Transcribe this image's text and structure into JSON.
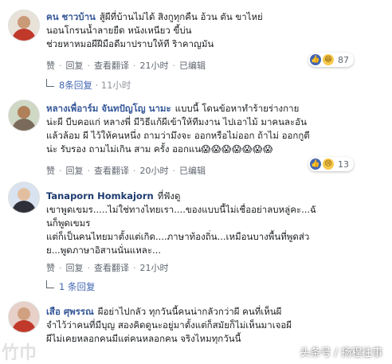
{
  "comments": [
    {
      "name": "คน ชาวบ้าน",
      "lines": [
        "สู้ผีที่บ้านไม่ได้ สิงกูทุกคืน อ้วน ตัน ขาไหย่",
        "นอนโกรนน้ำลายยืด หนังเหนียว ขี้บ่น",
        "ช่วยหาหมอผีฝีมือดีมาปราบให้ที ริาคาญมัน"
      ],
      "first_line_rest": "สู้ผีที่บ้านไม่ได้ สิงกูทุกคืน อ้วน ตัน ขาไหย่",
      "like": "赞",
      "reply": "回复",
      "translate": "查看翻译",
      "time": "21小时",
      "edited": "已编辑",
      "reaction_count": "87",
      "replies_text": "8条回复",
      "replies_time": "11小时"
    },
    {
      "name": "หลางเพื่อาร์ม จันทปัญโญ นามะ",
      "first_line_rest": "แบบนี้ โดนข้อหาทำร้ายร่างกาย",
      "lines": [
        "น่ะผี บีบคอแก่ หลางพี่ มีวิธีแก้ผีเข้าให้ทีมงาน ไปเอาไม้ มาคนละอัน",
        "แล้วล้อม ผี ไว้ให้คนหนึ่ง ถามว่ามึงจะ ออกหรือไม่ออก ถ้าไม่ ออกกูตี",
        "น่ะ รับรอง ถามไม่เกิน สาม ครั้ง ออกแน"
      ],
      "like": "赞",
      "reply": "回复",
      "translate": "查看翻译",
      "time": "20小时",
      "edited": "已编辑",
      "reaction_count": "13"
    },
    {
      "name": "Tanaporn Homkajorn",
      "first_line_rest": "ที่ฟังดู",
      "lines": [
        "เขาพูดเขมร.....ไม่ใช่ทางไทยเรา....ของแบบนี้ไม่เชื่ออย่าลบหลู่คะ...ฉั",
        "นก็พูดเขมร",
        "แต่ก็เป็นคนไทยมาตั้งแต่เกิด....ภาษาท้องถิ่น...เหมือนบางพื้นที่พูดส่ว",
        "ย...พูดภาษาอิสานนั่นแหละ..."
      ],
      "like": "赞",
      "reply": "回复",
      "translate": "查看翻译",
      "time": "21小时",
      "replies_text": "1 条回复"
    },
    {
      "name": "เสือ ศุพรรณ",
      "first_line_rest": "ผีอย่าไปกลัว ทุกวันนี้คนน่ากลัวกว่าผี คนที่เห็นผี",
      "lines": [
        "จำไว้ว่าคนที่มีบุญ สองคิดดูนะอยู่มาตั้งแต่ก็สมัยก็ไม่เห็นมาเจอผี",
        "ผีไม่เคยหลอกคนมีแต่คนหลอกคน จริงไหมทุกวันนี้"
      ]
    }
  ],
  "watermark": "头条号 / 扬程往事",
  "watermark_left": "竹巾"
}
